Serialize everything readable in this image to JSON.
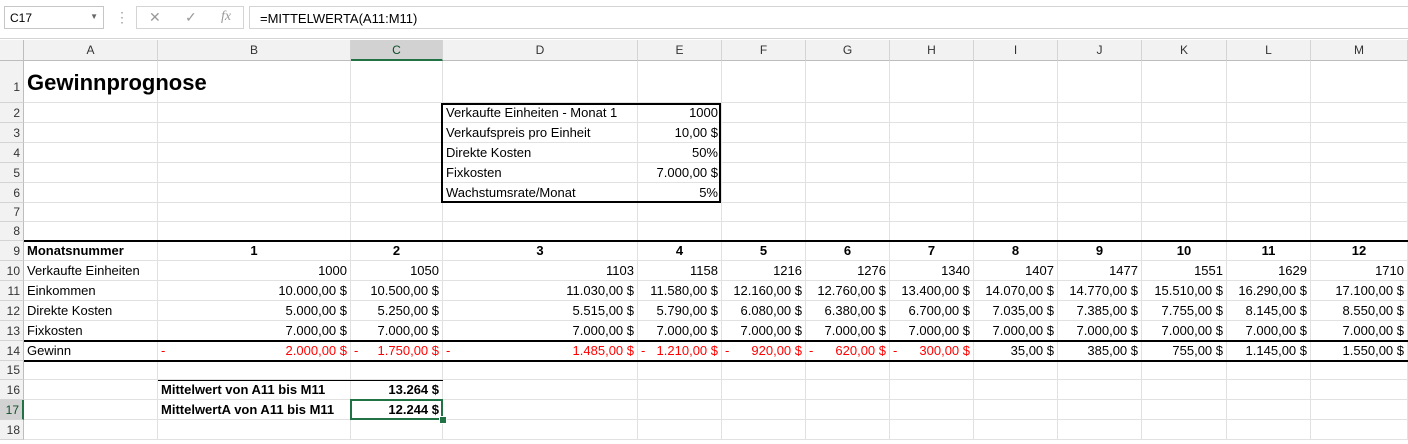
{
  "formula_bar": {
    "name_box": "C17",
    "cancel_icon": "✕",
    "enter_icon": "✓",
    "fx_icon": "fx",
    "formula": "=MITTELWERTA(A11:M11)"
  },
  "columns": [
    "A",
    "B",
    "C",
    "D",
    "E",
    "F",
    "G",
    "H",
    "I",
    "J",
    "K",
    "L",
    "M"
  ],
  "selected_column": "C",
  "rows": [
    "1",
    "2",
    "3",
    "4",
    "5",
    "6",
    "7",
    "8",
    "9",
    "10",
    "11",
    "12",
    "13",
    "14",
    "15",
    "16",
    "17",
    "18"
  ],
  "selected_row": "17",
  "title": "Gewinnprognose",
  "parameters": [
    {
      "label": "Verkaufte Einheiten - Monat 1",
      "value": "1000"
    },
    {
      "label": "Verkaufspreis pro Einheit",
      "value": "10,00 $"
    },
    {
      "label": "Direkte Kosten",
      "value": "50%"
    },
    {
      "label": "Fixkosten",
      "value": "7.000,00 $"
    },
    {
      "label": "Wachstumsrate/Monat",
      "value": "5%"
    }
  ],
  "table": {
    "header_label": "Monatsnummer",
    "months": [
      "1",
      "2",
      "3",
      "4",
      "5",
      "6",
      "7",
      "8",
      "9",
      "10",
      "11",
      "12"
    ],
    "rows": [
      {
        "label": "Verkaufte Einheiten",
        "values": [
          "1000",
          "1050",
          "1103",
          "1158",
          "1216",
          "1276",
          "1340",
          "1407",
          "1477",
          "1551",
          "1629",
          "1710"
        ]
      },
      {
        "label": "Einkommen",
        "values": [
          "10.000,00 $",
          "10.500,00 $",
          "11.030,00 $",
          "11.580,00 $",
          "12.160,00 $",
          "12.760,00 $",
          "13.400,00 $",
          "14.070,00 $",
          "14.770,00 $",
          "15.510,00 $",
          "16.290,00 $",
          "17.100,00 $"
        ]
      },
      {
        "label": "Direkte Kosten",
        "values": [
          "5.000,00 $",
          "5.250,00 $",
          "5.515,00 $",
          "5.790,00 $",
          "6.080,00 $",
          "6.380,00 $",
          "6.700,00 $",
          "7.035,00 $",
          "7.385,00 $",
          "7.755,00 $",
          "8.145,00 $",
          "8.550,00 $"
        ]
      },
      {
        "label": "Fixkosten",
        "values": [
          "7.000,00 $",
          "7.000,00 $",
          "7.000,00 $",
          "7.000,00 $",
          "7.000,00 $",
          "7.000,00 $",
          "7.000,00 $",
          "7.000,00 $",
          "7.000,00 $",
          "7.000,00 $",
          "7.000,00 $",
          "7.000,00 $"
        ]
      }
    ],
    "profit": {
      "label": "Gewinn",
      "minus_sign": "-",
      "values": [
        {
          "v": "2.000,00 $",
          "neg": true
        },
        {
          "v": "1.750,00 $",
          "neg": true
        },
        {
          "v": "1.485,00 $",
          "neg": true
        },
        {
          "v": "1.210,00 $",
          "neg": true
        },
        {
          "v": "920,00 $",
          "neg": true
        },
        {
          "v": "620,00 $",
          "neg": true
        },
        {
          "v": "300,00 $",
          "neg": true
        },
        {
          "v": "35,00 $",
          "neg": false
        },
        {
          "v": "385,00 $",
          "neg": false
        },
        {
          "v": "755,00 $",
          "neg": false
        },
        {
          "v": "1.145,00 $",
          "neg": false
        },
        {
          "v": "1.550,00 $",
          "neg": false
        }
      ]
    }
  },
  "averages": [
    {
      "label": "Mittelwert von A11 bis M11",
      "value": "13.264 $"
    },
    {
      "label": "MittelwertA von A11 bis M11",
      "value": "12.244 $"
    }
  ],
  "colors": {
    "accent": "#217346",
    "negative": "#ff0000"
  }
}
